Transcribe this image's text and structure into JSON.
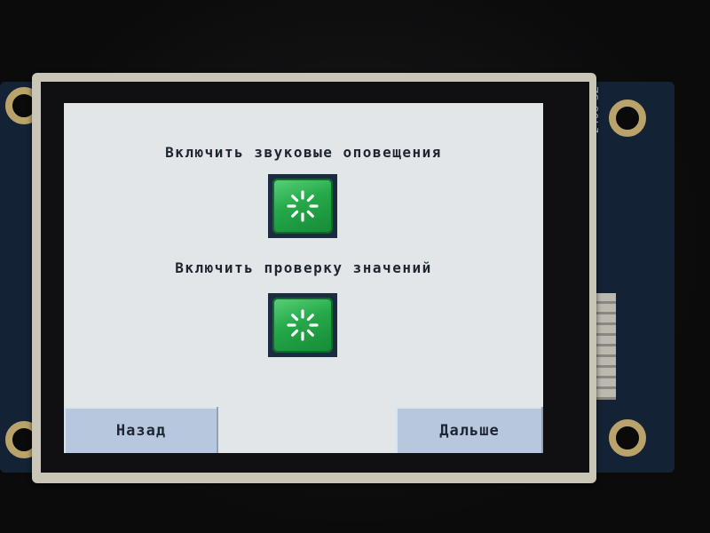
{
  "screen": {
    "sound_alerts": {
      "label": "Включить звуковые оповещения",
      "icon": "loading-spinner-icon"
    },
    "value_check": {
      "label": "Включить проверку значений",
      "icon": "loading-spinner-icon"
    },
    "buttons": {
      "back": "Назад",
      "next": "Дальше"
    }
  },
  "hardware": {
    "board_label": "2408-SZ"
  },
  "colors": {
    "screen_background": "#e2e6e8",
    "toggle_green": "#25a84a",
    "button_blue": "#b7c8de",
    "text_dark": "#1d2530"
  }
}
